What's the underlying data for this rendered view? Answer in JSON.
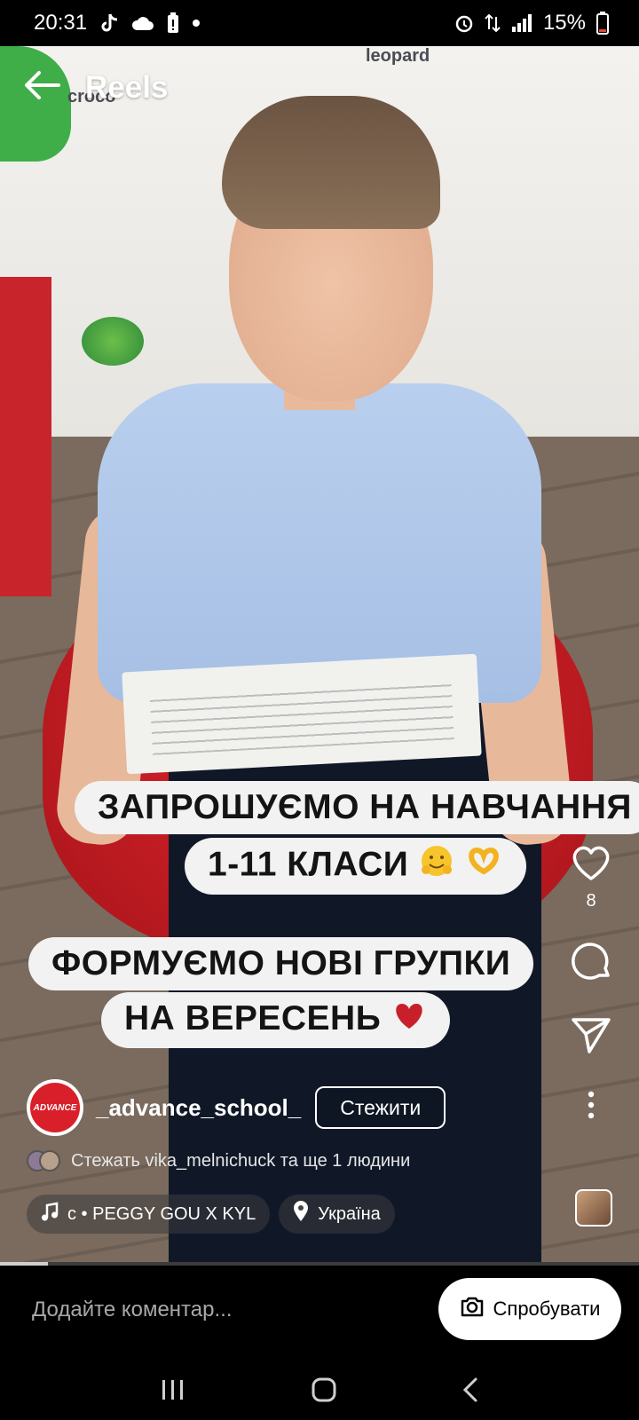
{
  "status_bar": {
    "time": "20:31",
    "battery": "15%",
    "icons": [
      "tiktok-icon",
      "cloud-icon",
      "battery-saver-icon",
      "dot-icon",
      "alarm-icon",
      "data-arrows-icon",
      "signal-icon",
      "battery-icon"
    ]
  },
  "header": {
    "title": "Reels",
    "back_icon": "arrow-left-icon"
  },
  "background": {
    "wall_text_1": "croco",
    "wall_text_2": "leopard"
  },
  "captions": {
    "line1": "ЗАПРОШУЄМО НА НАВЧАННЯ",
    "line2": "1-11 КЛАСИ",
    "line3": "ФОРМУЄМО НОВІ ГРУПКИ",
    "line4": "НА ВЕРЕСЕНЬ"
  },
  "actions": {
    "like_count": "8",
    "icons": [
      "heart-icon",
      "comment-icon",
      "send-icon",
      "more-vertical-icon"
    ]
  },
  "author": {
    "username": "_advance_school_",
    "avatar_text": "ADVANCE",
    "follow_label": "Стежити"
  },
  "followed_by": "Стежать vika_melnichuck та ще 1 людини",
  "audio": {
    "label": "c • PEGGY GOU X KYL",
    "location": "Україна"
  },
  "progress": 0.075,
  "comment_bar": {
    "placeholder": "Додайте коментар...",
    "try_label": "Спробувати"
  },
  "colors": {
    "caption_bg": "#f2f2f2",
    "brand_red": "#d9202a",
    "background": "#000000"
  }
}
